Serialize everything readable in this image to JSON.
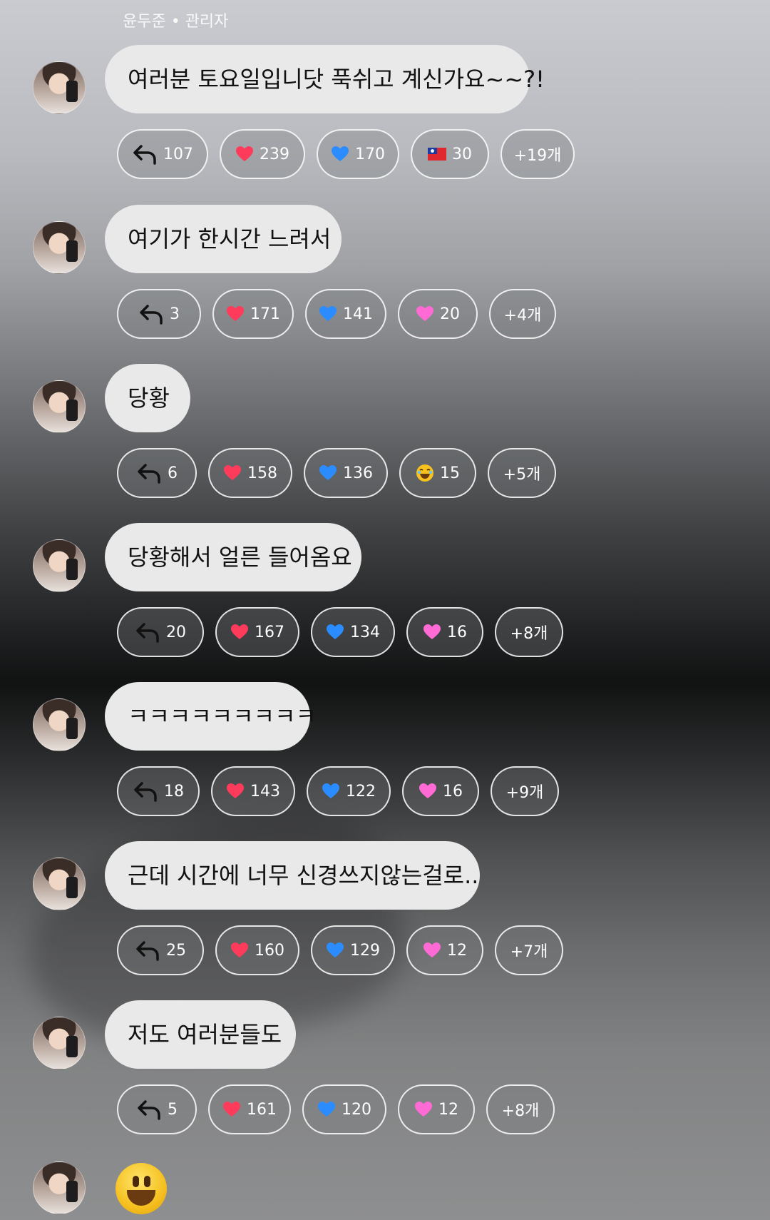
{
  "header": {
    "author": "윤두준 • 관리자"
  },
  "messages": [
    {
      "text": "여러분 토요일입니닷 푹쉬고 계신가요~~?!",
      "reply": "107",
      "heart": "239",
      "blue_heart": "170",
      "third_icon": "taiwan-flag-icon",
      "third": "30",
      "more": "+19개"
    },
    {
      "text": "여기가 한시간 느려서",
      "reply": "3",
      "heart": "171",
      "blue_heart": "141",
      "third_icon": "pink-heart-icon",
      "third": "20",
      "more": "+4개"
    },
    {
      "text": "당황",
      "reply": "6",
      "heart": "158",
      "blue_heart": "136",
      "third_icon": "laughing-emoji-icon",
      "third": "15",
      "more": "+5개"
    },
    {
      "text": "당황해서 얼른 들어옴요",
      "reply": "20",
      "heart": "167",
      "blue_heart": "134",
      "third_icon": "pink-heart-icon",
      "third": "16",
      "more": "+8개"
    },
    {
      "text": "ㅋㅋㅋㅋㅋㅋㅋㅋㅋ",
      "reply": "18",
      "heart": "143",
      "blue_heart": "122",
      "third_icon": "pink-heart-icon",
      "third": "16",
      "more": "+9개"
    },
    {
      "text": "근데 시간에 너무 신경쓰지않는걸로..",
      "reply": "25",
      "heart": "160",
      "blue_heart": "129",
      "third_icon": "pink-heart-icon",
      "third": "12",
      "more": "+7개"
    },
    {
      "text": "저도 여러분들도",
      "reply": "5",
      "heart": "161",
      "blue_heart": "120",
      "third_icon": "pink-heart-icon",
      "third": "12",
      "more": "+8개"
    }
  ],
  "last_message": {
    "icon": "grinning-emoji-icon"
  },
  "colors": {
    "bubble": "#e9e9ea",
    "heart": "#ff3b5c",
    "blue_heart": "#2a8cff",
    "pink_heart": "#ff6ad5"
  }
}
